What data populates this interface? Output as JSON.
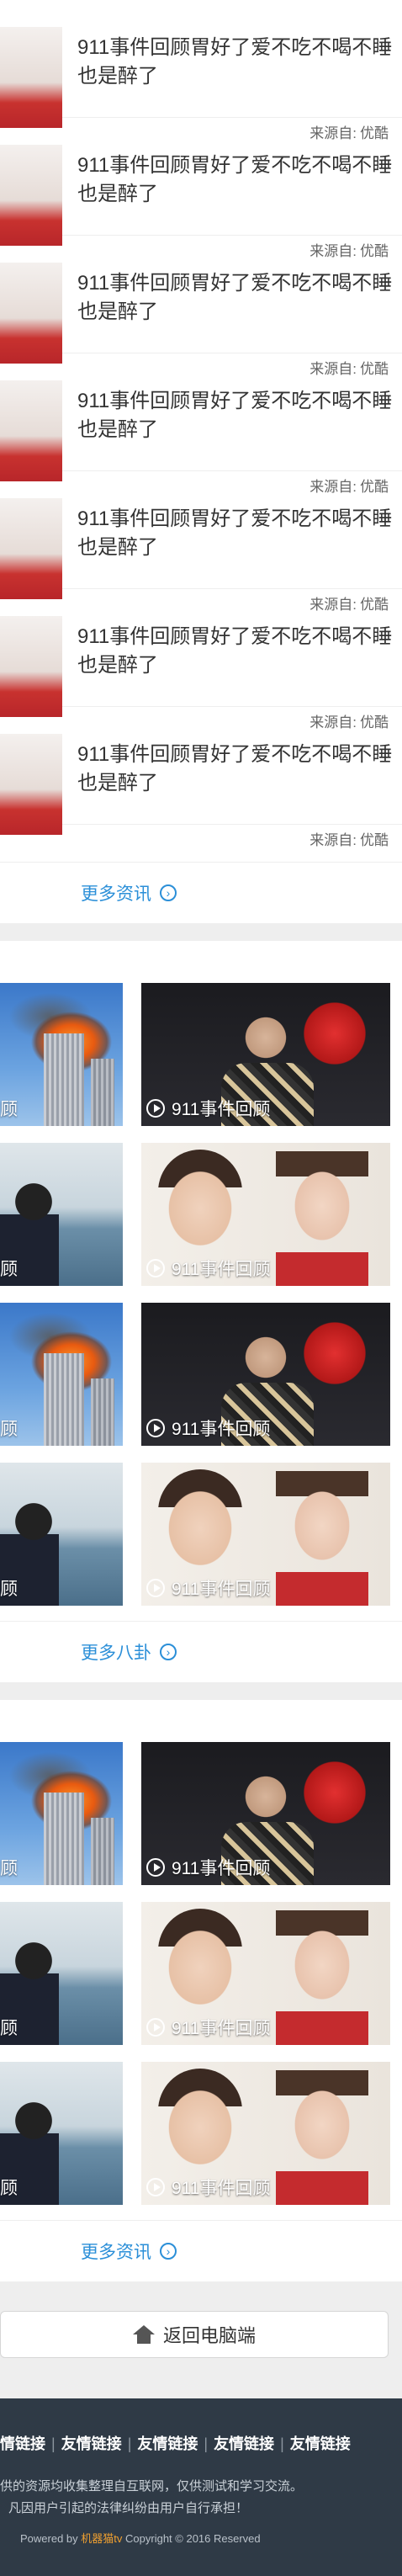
{
  "news": {
    "items": [
      {
        "title": "911事件回顾胃好了爱不吃不喝不睡也是醉了",
        "source_prefix": "来源自:",
        "source": "优酷"
      },
      {
        "title": "911事件回顾胃好了爱不吃不喝不睡也是醉了",
        "source_prefix": "来源自:",
        "source": "优酷"
      },
      {
        "title": "911事件回顾胃好了爱不吃不喝不睡也是醉了",
        "source_prefix": "来源自:",
        "source": "优酷"
      },
      {
        "title": "911事件回顾胃好了爱不吃不喝不睡也是醉了",
        "source_prefix": "来源自:",
        "source": "优酷"
      },
      {
        "title": "911事件回顾胃好了爱不吃不喝不睡也是醉了",
        "source_prefix": "来源自:",
        "source": "优酷"
      },
      {
        "title": "911事件回顾胃好了爱不吃不喝不睡也是醉了",
        "source_prefix": "来源自:",
        "source": "优酷"
      },
      {
        "title": "911事件回顾胃好了爱不吃不喝不睡也是醉了",
        "source_prefix": "来源自:",
        "source": "优酷"
      }
    ],
    "more_label": "更多资讯"
  },
  "gossip": {
    "video_caption": "911事件回顾",
    "cut_caption": "顾",
    "more_label": "更多八卦"
  },
  "videos2": {
    "video_caption": "911事件回顾",
    "cut_caption": "顾",
    "more_label": "更多资讯"
  },
  "back": {
    "label": "返回电脑端"
  },
  "footer": {
    "links": [
      "情链接",
      "友情链接",
      "友情链接",
      "友情链接",
      "友情链接"
    ],
    "disclaimer_line1": "供的资源均收集整理自互联网，仅供测试和学习交流。",
    "disclaimer_line2": "凡因用户引起的法律纠纷由用户自行承担！",
    "copyright_prefix": "Powered by",
    "brand": "机器猫tv",
    "copyright_suffix": "Copyright © 2016 Reserved"
  },
  "icons": {
    "more": "chevron-right-circle-icon",
    "play": "play-icon",
    "home": "home-icon"
  },
  "colors": {
    "link": "#2b8fd8",
    "footer_bg": "#2f3a46",
    "brand": "#f0a030"
  }
}
